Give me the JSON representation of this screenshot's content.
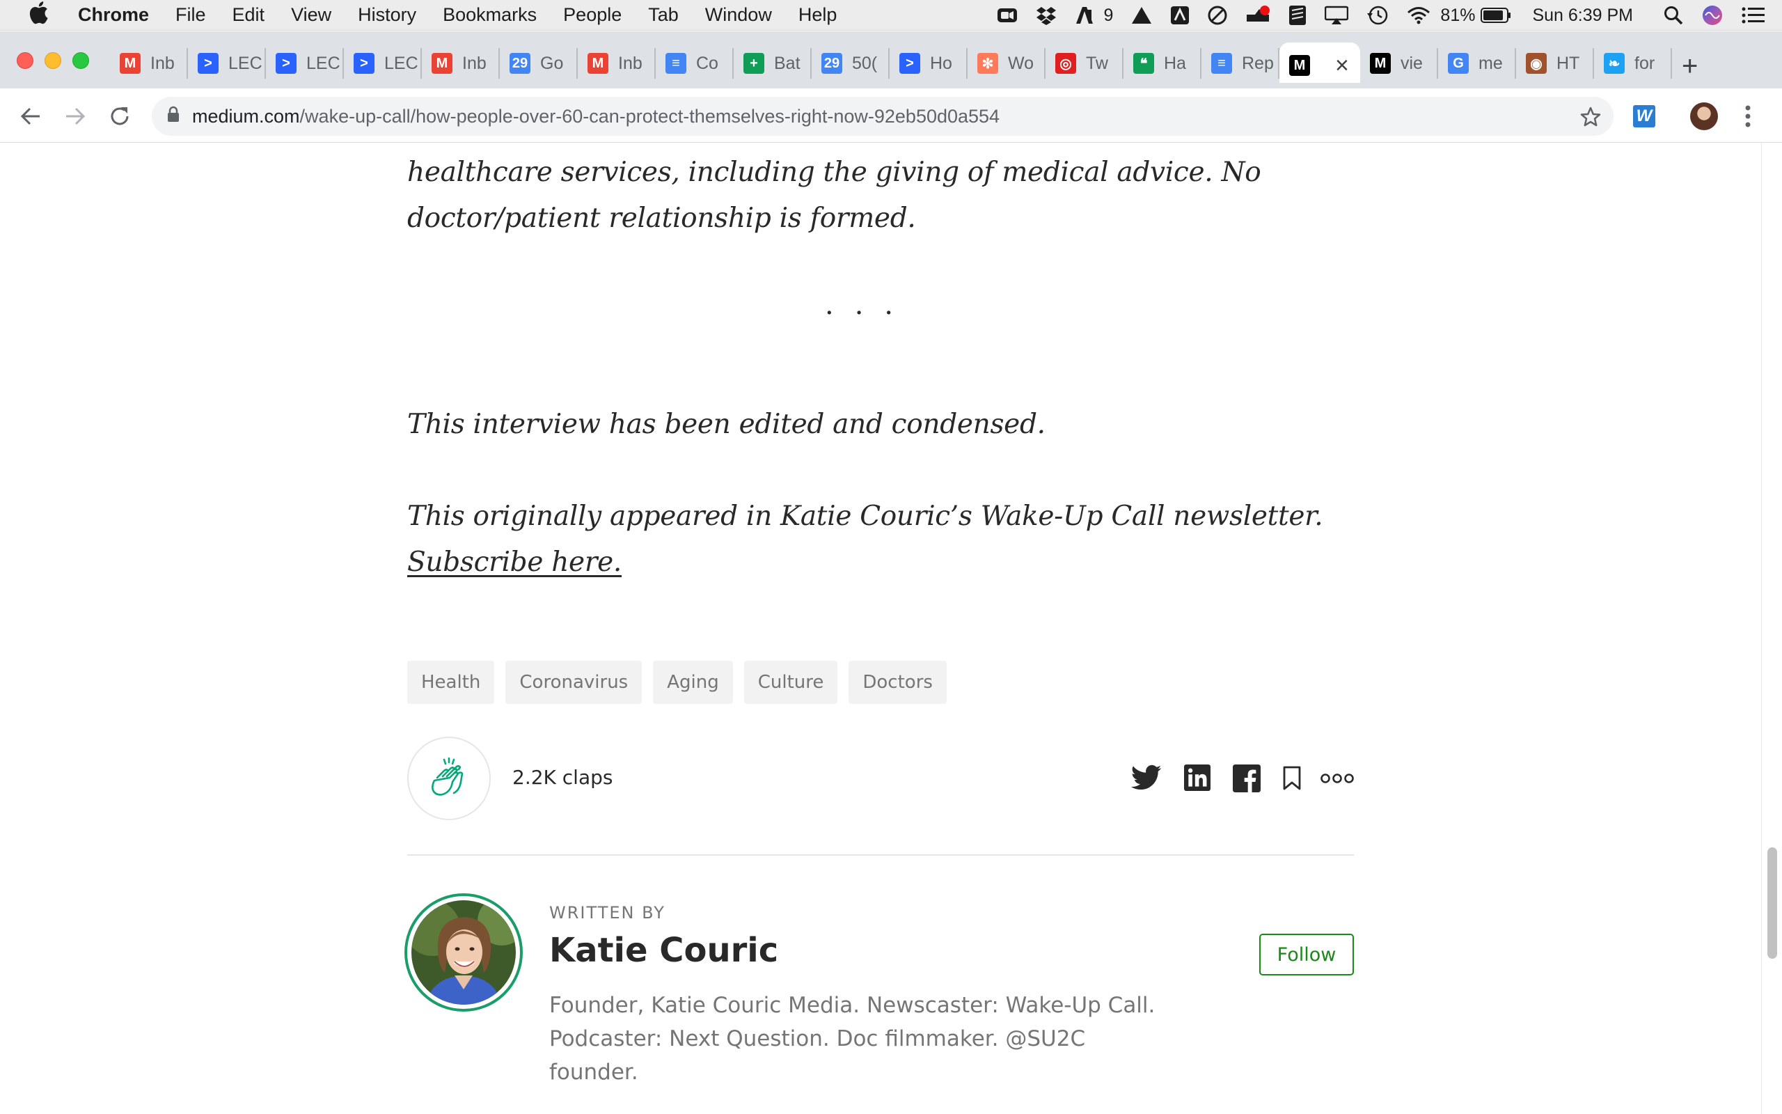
{
  "menubar": {
    "app": "Chrome",
    "items": [
      "File",
      "Edit",
      "View",
      "History",
      "Bookmarks",
      "People",
      "Tab",
      "Window",
      "Help"
    ],
    "adobe_count": "9",
    "battery": "81%",
    "clock": "Sun 6:39 PM"
  },
  "tabs": [
    {
      "label": "Inb",
      "icon": "gmail-icon",
      "color": "#ea4335",
      "glyph": "M"
    },
    {
      "label": "LEC",
      "icon": "lec-icon",
      "color": "#2962ff",
      "glyph": ">"
    },
    {
      "label": "LEC",
      "icon": "lec-icon",
      "color": "#2962ff",
      "glyph": ">"
    },
    {
      "label": "LEC",
      "icon": "lec-icon",
      "color": "#2962ff",
      "glyph": ">"
    },
    {
      "label": "Inb",
      "icon": "gmail-icon",
      "color": "#ea4335",
      "glyph": "M"
    },
    {
      "label": "Go",
      "icon": "calendar-icon",
      "color": "#4285f4",
      "glyph": "29"
    },
    {
      "label": "Inb",
      "icon": "gmail-icon",
      "color": "#ea4335",
      "glyph": "M"
    },
    {
      "label": "Co",
      "icon": "docs-icon",
      "color": "#4285f4",
      "glyph": "≡"
    },
    {
      "label": "Bat",
      "icon": "sheets-icon",
      "color": "#0f9d58",
      "glyph": "+"
    },
    {
      "label": "50(",
      "icon": "calendar-icon",
      "color": "#4285f4",
      "glyph": "29"
    },
    {
      "label": "Ho",
      "icon": "lec-icon",
      "color": "#2962ff",
      "glyph": ">"
    },
    {
      "label": "Wo",
      "icon": "hubspot-icon",
      "color": "#ff7a59",
      "glyph": "✻"
    },
    {
      "label": "Tw",
      "icon": "target-icon",
      "color": "#e02020",
      "glyph": "◎"
    },
    {
      "label": "Ha",
      "icon": "hangouts-icon",
      "color": "#0f9d58",
      "glyph": "❝"
    },
    {
      "label": "Rep",
      "icon": "docs-icon",
      "color": "#4285f4",
      "glyph": "≡"
    }
  ],
  "active_tab": {
    "icon": "medium-icon",
    "glyph": "M"
  },
  "tabs_after": [
    {
      "label": "vie",
      "icon": "medium-icon",
      "color": "#000000",
      "glyph": "M"
    },
    {
      "label": "me",
      "icon": "google-icon",
      "color": "#4285f4",
      "glyph": "G"
    },
    {
      "label": "HT",
      "icon": "html-icon",
      "color": "#a0522d",
      "glyph": "◉"
    },
    {
      "label": "for",
      "icon": "bird-icon",
      "color": "#1da1f2",
      "glyph": "❧"
    }
  ],
  "omnibox": {
    "host": "medium.com",
    "path": "/wake-up-call/how-people-over-60-can-protect-themselves-right-now-92eb50d0a554"
  },
  "article": {
    "disclaimer_tail": "healthcare services, including the giving of medical advice. No doctor/patient relationship is formed.",
    "edited_note": "This interview has been edited and condensed.",
    "origin_note": "This originally appeared in Katie Couric’s Wake-Up Call newsletter. ",
    "subscribe_link": "Subscribe here."
  },
  "tags": [
    "Health",
    "Coronavirus",
    "Aging",
    "Culture",
    "Doctors"
  ],
  "claps": "2.2K claps",
  "author": {
    "written_by": "WRITTEN BY",
    "name": "Katie Couric",
    "bio": "Founder, Katie Couric Media. Newscaster: Wake-Up Call. Podcaster: Next Question. Doc filmmaker. @SU2C founder.",
    "follow_label": "Follow"
  },
  "colors": {
    "accent_green": "#1a8917",
    "ring_green": "#1a9d68",
    "clap_green": "#03a87c"
  }
}
